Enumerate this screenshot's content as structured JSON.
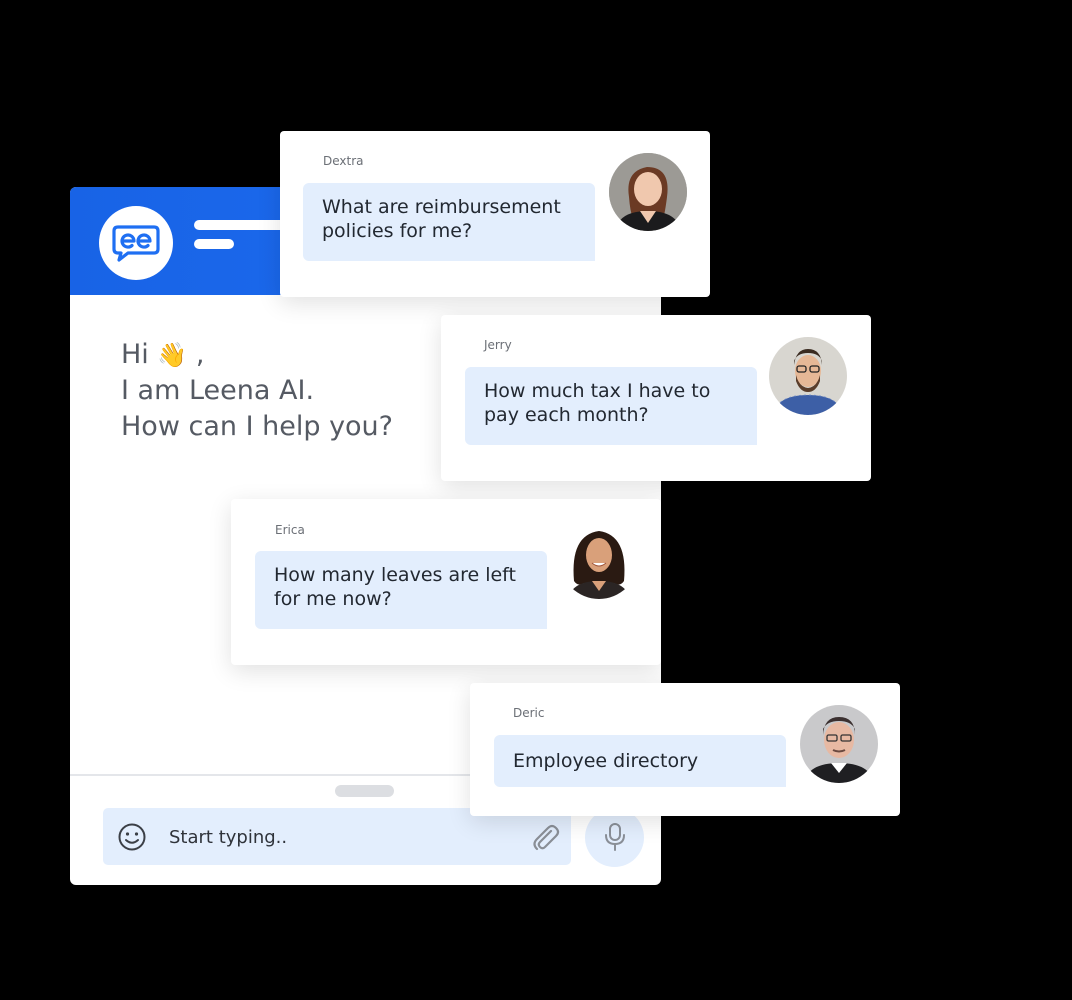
{
  "widget": {
    "brand_icon": "leena-ai-chat-logo",
    "greeting": {
      "line1_text": "Hi",
      "line1_emoji": "👋",
      "line1_suffix": ",",
      "line2": "I am Leena AI.",
      "line3": "How can I help you?"
    },
    "composer": {
      "placeholder": "Start typing..",
      "emoji_icon": "smiley-icon",
      "attach_icon": "paperclip-icon",
      "mic_icon": "microphone-icon"
    }
  },
  "messages": [
    {
      "sender": "Dextra",
      "text": "What are reimbursement policies for me?",
      "avatar": "avatar-dextra"
    },
    {
      "sender": "Jerry",
      "text": "How much tax I have to pay each month?",
      "avatar": "avatar-jerry"
    },
    {
      "sender": "Erica",
      "text": "How many leaves are left for me now?",
      "avatar": "avatar-erica"
    },
    {
      "sender": "Deric",
      "text": "Employee directory",
      "avatar": "avatar-deric"
    }
  ],
  "colors": {
    "brand_blue": "#1f6ff2",
    "bubble_bg": "#e3eefd",
    "page_bg": "#000000"
  }
}
